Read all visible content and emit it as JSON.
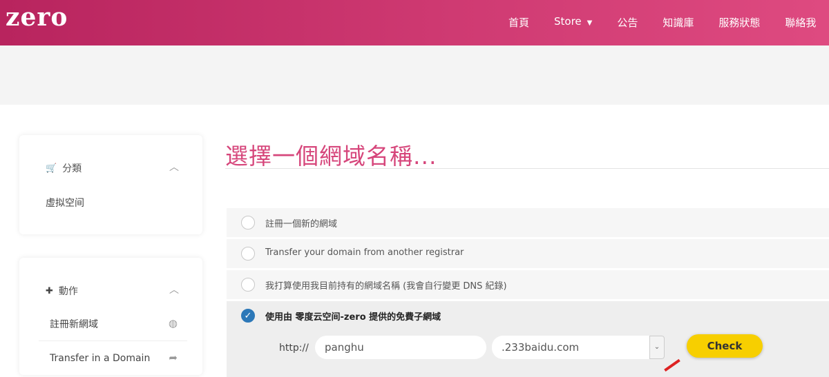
{
  "brand": {
    "logo_text": "zero"
  },
  "nav": {
    "items": [
      "首頁",
      "Store",
      "公告",
      "知識庫",
      "服務狀態",
      "聯絡我"
    ],
    "store_caret_icon": "caret-down-icon"
  },
  "sidebar": {
    "categories": {
      "header": "分類",
      "header_icon": "cart-icon",
      "items": [
        "虛拟空间"
      ]
    },
    "actions": {
      "header": "動作",
      "header_icon": "plus-icon",
      "items": [
        {
          "label": "註冊新網域",
          "icon": "globe-icon"
        },
        {
          "label": "Transfer in a Domain",
          "icon": "share-arrow-icon"
        }
      ]
    }
  },
  "main": {
    "title": "選擇一個網域名稱...",
    "options": [
      {
        "label": "註冊一個新的網域",
        "selected": false
      },
      {
        "label": "Transfer your domain from another registrar",
        "selected": false
      },
      {
        "label": "我打算使用我目前持有的網域名稱 (我會自行變更 DNS 紀錄)",
        "selected": false
      },
      {
        "label": "使用由 零度云空间-zero 提供的免費子網域",
        "selected": true
      }
    ],
    "subdomain": {
      "prefix": "http://",
      "value": "panghu",
      "domain_value": ".233baidu.com",
      "check_label": "Check"
    }
  },
  "colors": {
    "brand": "#c8306a",
    "title": "#d6467b",
    "check": "#f7cf00",
    "radio_selected": "#2c78b8"
  }
}
